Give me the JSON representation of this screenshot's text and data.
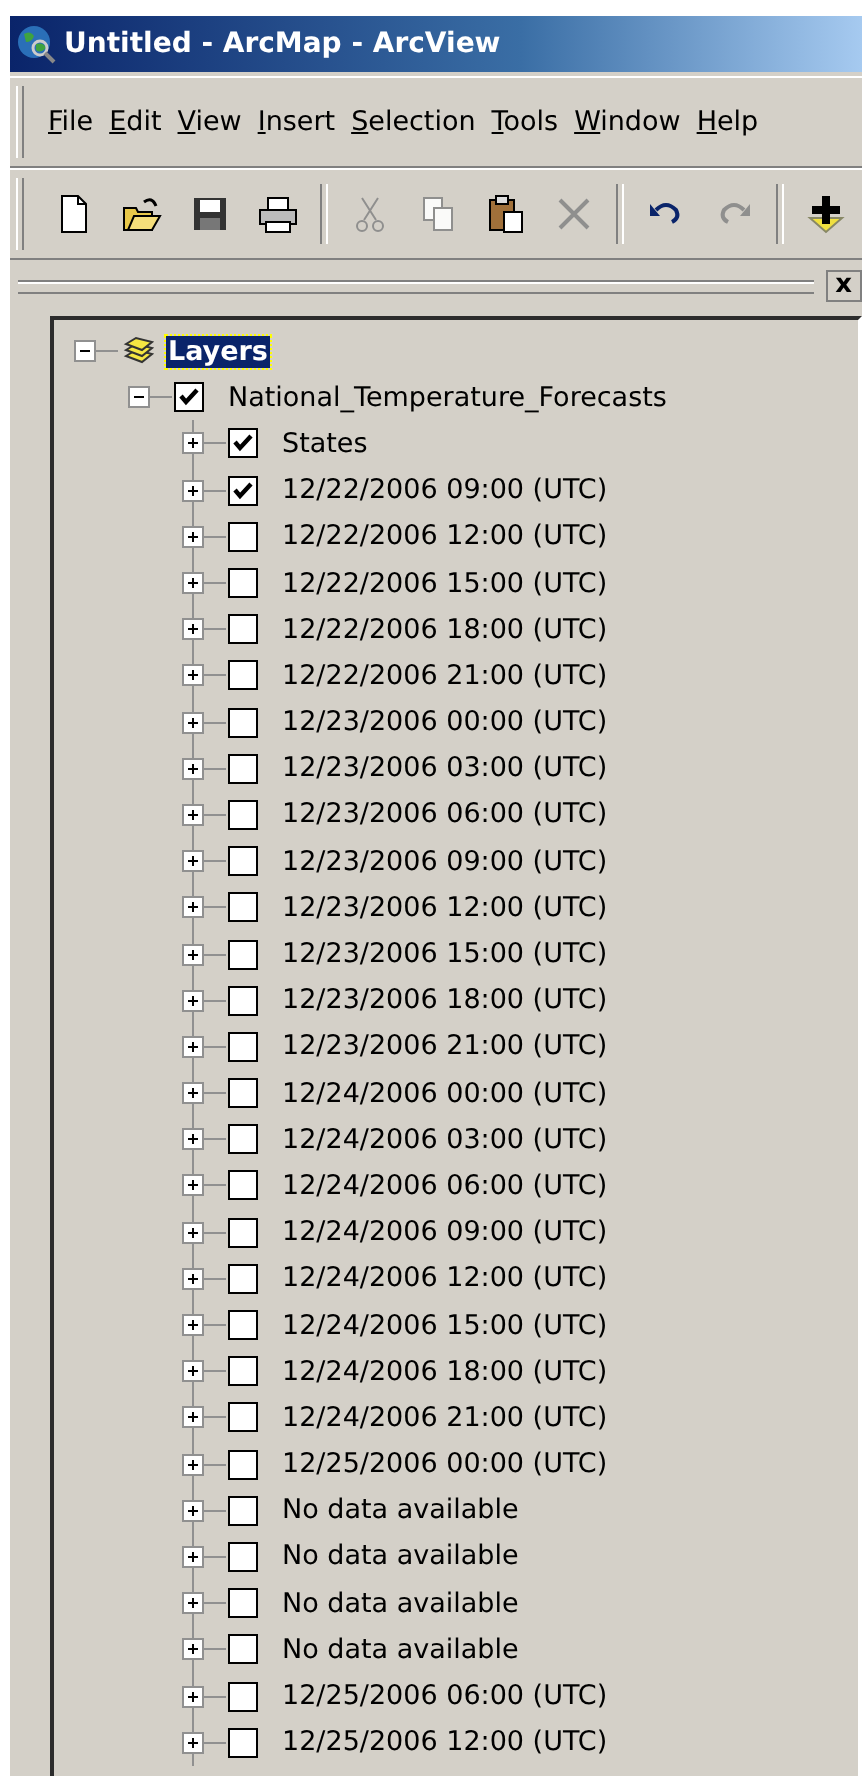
{
  "window": {
    "title": "Untitled - ArcMap - ArcView"
  },
  "menu": [
    "File",
    "Edit",
    "View",
    "Insert",
    "Selection",
    "Tools",
    "Window",
    "Help"
  ],
  "toolbar": [
    {
      "kind": "new",
      "disabled": false
    },
    {
      "kind": "open",
      "disabled": false
    },
    {
      "kind": "save",
      "disabled": false
    },
    {
      "kind": "print",
      "disabled": false
    },
    {
      "kind": "separator"
    },
    {
      "kind": "cut",
      "disabled": true
    },
    {
      "kind": "copy",
      "disabled": true
    },
    {
      "kind": "paste",
      "disabled": false
    },
    {
      "kind": "delete",
      "disabled": true
    },
    {
      "kind": "separator"
    },
    {
      "kind": "undo",
      "disabled": false
    },
    {
      "kind": "redo",
      "disabled": true
    },
    {
      "kind": "separator"
    },
    {
      "kind": "add_data",
      "disabled": false
    }
  ],
  "dock": {
    "close": "x"
  },
  "tree": [
    {
      "kind": "data_frame",
      "label": "Layers",
      "selected": true,
      "expanded": true,
      "children": [
        {
          "kind": "layer",
          "label": "National_Temperature_Forecasts",
          "selected": false,
          "checked": true,
          "expanded": true,
          "children": [
            {
              "kind": "layer",
              "label": "States",
              "selected": false,
              "checked": true,
              "expanded": false
            },
            {
              "kind": "layer",
              "label": "12/22/2006 09:00 (UTC)",
              "selected": false,
              "checked": true,
              "expanded": false
            },
            {
              "kind": "layer",
              "label": "12/22/2006 12:00 (UTC)",
              "selected": false,
              "checked": false,
              "expanded": false
            },
            {
              "kind": "layer",
              "label": "12/22/2006 15:00 (UTC)",
              "selected": false,
              "checked": false,
              "expanded": false
            },
            {
              "kind": "layer",
              "label": "12/22/2006 18:00 (UTC)",
              "selected": false,
              "checked": false,
              "expanded": false
            },
            {
              "kind": "layer",
              "label": "12/22/2006 21:00 (UTC)",
              "selected": false,
              "checked": false,
              "expanded": false
            },
            {
              "kind": "layer",
              "label": "12/23/2006 00:00 (UTC)",
              "selected": false,
              "checked": false,
              "expanded": false
            },
            {
              "kind": "layer",
              "label": "12/23/2006 03:00 (UTC)",
              "selected": false,
              "checked": false,
              "expanded": false
            },
            {
              "kind": "layer",
              "label": "12/23/2006 06:00 (UTC)",
              "selected": false,
              "checked": false,
              "expanded": false
            },
            {
              "kind": "layer",
              "label": "12/23/2006 09:00 (UTC)",
              "selected": false,
              "checked": false,
              "expanded": false
            },
            {
              "kind": "layer",
              "label": "12/23/2006 12:00 (UTC)",
              "selected": false,
              "checked": false,
              "expanded": false
            },
            {
              "kind": "layer",
              "label": "12/23/2006 15:00 (UTC)",
              "selected": false,
              "checked": false,
              "expanded": false
            },
            {
              "kind": "layer",
              "label": "12/23/2006 18:00 (UTC)",
              "selected": false,
              "checked": false,
              "expanded": false
            },
            {
              "kind": "layer",
              "label": "12/23/2006 21:00 (UTC)",
              "selected": false,
              "checked": false,
              "expanded": false
            },
            {
              "kind": "layer",
              "label": "12/24/2006 00:00 (UTC)",
              "selected": false,
              "checked": false,
              "expanded": false
            },
            {
              "kind": "layer",
              "label": "12/24/2006 03:00 (UTC)",
              "selected": false,
              "checked": false,
              "expanded": false
            },
            {
              "kind": "layer",
              "label": "12/24/2006 06:00 (UTC)",
              "selected": false,
              "checked": false,
              "expanded": false
            },
            {
              "kind": "layer",
              "label": "12/24/2006 09:00 (UTC)",
              "selected": false,
              "checked": false,
              "expanded": false
            },
            {
              "kind": "layer",
              "label": "12/24/2006 12:00 (UTC)",
              "selected": false,
              "checked": false,
              "expanded": false
            },
            {
              "kind": "layer",
              "label": "12/24/2006 15:00 (UTC)",
              "selected": false,
              "checked": false,
              "expanded": false
            },
            {
              "kind": "layer",
              "label": "12/24/2006 18:00 (UTC)",
              "selected": false,
              "checked": false,
              "expanded": false
            },
            {
              "kind": "layer",
              "label": "12/24/2006 21:00 (UTC)",
              "selected": false,
              "checked": false,
              "expanded": false
            },
            {
              "kind": "layer",
              "label": "12/25/2006 00:00 (UTC)",
              "selected": false,
              "checked": false,
              "expanded": false
            },
            {
              "kind": "layer",
              "label": "No data available",
              "selected": false,
              "checked": false,
              "expanded": false
            },
            {
              "kind": "layer",
              "label": "No data available",
              "selected": false,
              "checked": false,
              "expanded": false
            },
            {
              "kind": "layer",
              "label": "No data available",
              "selected": false,
              "checked": false,
              "expanded": false
            },
            {
              "kind": "layer",
              "label": "No data available",
              "selected": false,
              "checked": false,
              "expanded": false
            },
            {
              "kind": "layer",
              "label": "12/25/2006 06:00 (UTC)",
              "selected": false,
              "checked": false,
              "expanded": false
            },
            {
              "kind": "layer",
              "label": "12/25/2006 12:00 (UTC)",
              "selected": false,
              "checked": false,
              "expanded": false
            }
          ]
        }
      ]
    }
  ]
}
